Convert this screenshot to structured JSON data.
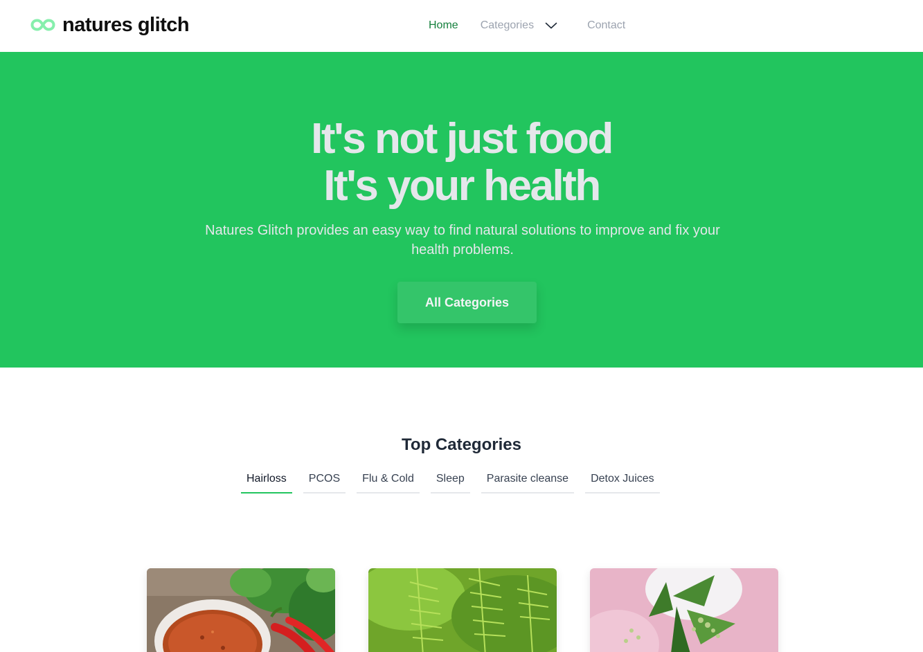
{
  "brand": {
    "name": "natures glitch",
    "icon": "infinity-icon",
    "icon_color": "#86efac"
  },
  "nav": {
    "home": "Home",
    "categories": "Categories",
    "contact": "Contact"
  },
  "hero": {
    "title_line1": "It's not just food",
    "title_line2": "It's your health",
    "subtitle": "Natures Glitch provides an easy way to find natural solutions to improve and fix your health problems.",
    "button": "All Categories",
    "background": "#22c55e"
  },
  "top_categories": {
    "title": "Top Categories",
    "tabs": [
      {
        "label": "Hairloss",
        "active": true
      },
      {
        "label": "PCOS",
        "active": false
      },
      {
        "label": "Flu & Cold",
        "active": false
      },
      {
        "label": "Sleep",
        "active": false
      },
      {
        "label": "Parasite cleanse",
        "active": false
      },
      {
        "label": "Detox Juices",
        "active": false
      }
    ]
  },
  "cards": [
    {
      "image": "chili-powder-bowl-photo"
    },
    {
      "image": "horsetail-plant-photo"
    },
    {
      "image": "nettle-plant-photo"
    }
  ]
}
